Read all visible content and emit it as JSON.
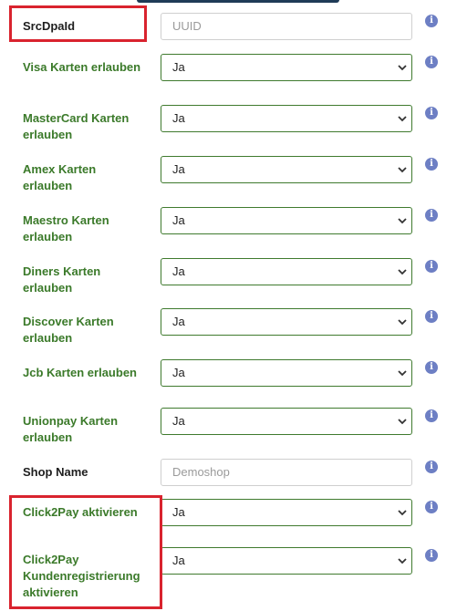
{
  "fields": [
    {
      "label": "SrcDpaId",
      "value": "UUID",
      "type": "text",
      "placeholder": true
    },
    {
      "label": "Visa Karten erlauben",
      "value": "Ja",
      "type": "select"
    },
    {
      "label": "MasterCard Karten erlauben",
      "value": "Ja",
      "type": "select"
    },
    {
      "label": "Amex Karten erlauben",
      "value": "Ja",
      "type": "select"
    },
    {
      "label": "Maestro Karten erlauben",
      "value": "Ja",
      "type": "select"
    },
    {
      "label": "Diners Karten erlauben",
      "value": "Ja",
      "type": "select"
    },
    {
      "label": "Discover Karten erlauben",
      "value": "Ja",
      "type": "select"
    },
    {
      "label": "Jcb Karten erlauben",
      "value": "Ja",
      "type": "select"
    },
    {
      "label": "Unionpay Karten erlauben",
      "value": "Ja",
      "type": "select"
    },
    {
      "label": "Shop Name",
      "value": "Demoshop",
      "type": "text",
      "placeholder": true
    },
    {
      "label": "Click2Pay aktivieren",
      "value": "Ja",
      "type": "select"
    },
    {
      "label": "Click2Pay Kundenregistrierung aktivieren",
      "value": "Ja",
      "type": "select"
    }
  ],
  "info_icon_glyph": "i",
  "colors": {
    "label_green": "#3b7a2a",
    "select_border": "#3f7a2e",
    "highlight_red": "#d9232e",
    "info_blue": "#6d7fc4"
  }
}
